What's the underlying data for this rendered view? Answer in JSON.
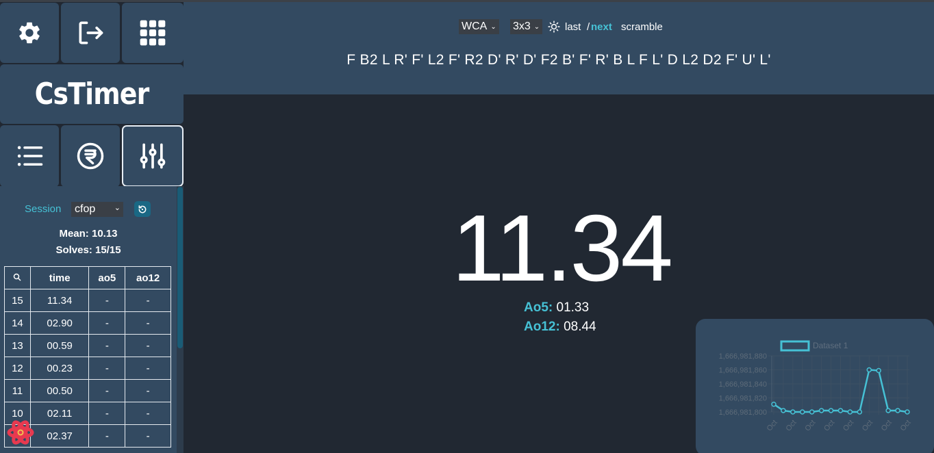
{
  "sidebar": {
    "logo": "CsTimer",
    "icons": [
      "gear-icon",
      "logout-icon",
      "apps-grid-icon",
      "list-icon",
      "rupee-icon",
      "sliders-icon"
    ],
    "session_label": "Session",
    "session_value": "cfop",
    "mean": "Mean: 10.13",
    "solves": "Solves: 15/15",
    "table": {
      "headers": [
        "time",
        "ao5",
        "ao12"
      ],
      "rows": [
        {
          "n": "15",
          "time": "11.34",
          "ao5": "-",
          "ao12": "-"
        },
        {
          "n": "14",
          "time": "02.90",
          "ao5": "-",
          "ao12": "-"
        },
        {
          "n": "13",
          "time": "00.59",
          "ao5": "-",
          "ao12": "-"
        },
        {
          "n": "12",
          "time": "00.23",
          "ao5": "-",
          "ao12": "-"
        },
        {
          "n": "11",
          "time": "00.50",
          "ao5": "-",
          "ao12": "-"
        },
        {
          "n": "10",
          "time": "02.11",
          "ao5": "-",
          "ao12": "-"
        },
        {
          "n": "",
          "time": "02.37",
          "ao5": "-",
          "ao12": "-"
        }
      ]
    }
  },
  "header": {
    "event_type": "WCA",
    "puzzle": "3x3",
    "last": "last",
    "separator": "/",
    "next": "next",
    "scramble_label": "scramble",
    "scramble": "F B2 L R' F' L2 F' R2 D' R' D' F2 B' F' R' B L F L' D L2 D2 F' U' L'"
  },
  "timer": {
    "time": "11.34",
    "ao5_label": "Ao5:",
    "ao5_value": "01.33",
    "ao12_label": "Ao12:",
    "ao12_value": "08.44"
  },
  "colors": {
    "accent": "#46c1d5",
    "panel": "#334a61",
    "background": "#212832"
  },
  "chart_data": {
    "type": "line",
    "legend": [
      "Dataset 1"
    ],
    "legend_position": "top",
    "x": [
      "Oct",
      "Oct",
      "Oct",
      "Oct",
      "Oct",
      "Oct",
      "Oct",
      "Oct",
      "Oct",
      "Oct",
      "Oct",
      "Oct",
      "Oct",
      "Oct",
      "Oct"
    ],
    "series": [
      {
        "name": "Dataset 1",
        "values": [
          1666981811,
          1666981802,
          1666981800,
          1666981800,
          1666981800,
          1666981802,
          1666981802,
          1666981802,
          1666981800,
          1666981800,
          1666981860,
          1666981859,
          1666981802,
          1666981802,
          1666981800
        ]
      }
    ],
    "y_ticks": [
      "1,666,981,880",
      "1,666,981,860",
      "1,666,981,840",
      "1,666,981,820",
      "1,666,981,800"
    ],
    "ylim": [
      1666981800,
      1666981880
    ],
    "grid": true,
    "color": "#46c1d5"
  }
}
